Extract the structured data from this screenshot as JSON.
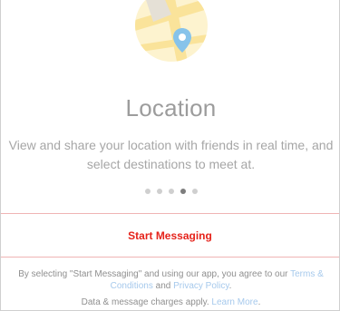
{
  "onboarding": {
    "hero_icon": "location-map-icon",
    "title": "Location",
    "description_line1": "View and share your location with friends in real time, and",
    "description_line2": "select destinations to meet at.",
    "pages_total": 5,
    "current_page": 4
  },
  "cta": {
    "label": "Start Messaging",
    "color": "#e5231b"
  },
  "legal": {
    "line1_prefix": "By selecting \"Start Messaging\" and using our app, you agree to our ",
    "terms_link_part1": "Terms &",
    "terms_link_part2": "Conditions",
    "and_text": " and ",
    "privacy_link": "Privacy Policy",
    "period": ".",
    "charges_text": "Data & message charges apply. ",
    "learn_more_link": "Learn More",
    "link_color": "#a6c9ec"
  }
}
